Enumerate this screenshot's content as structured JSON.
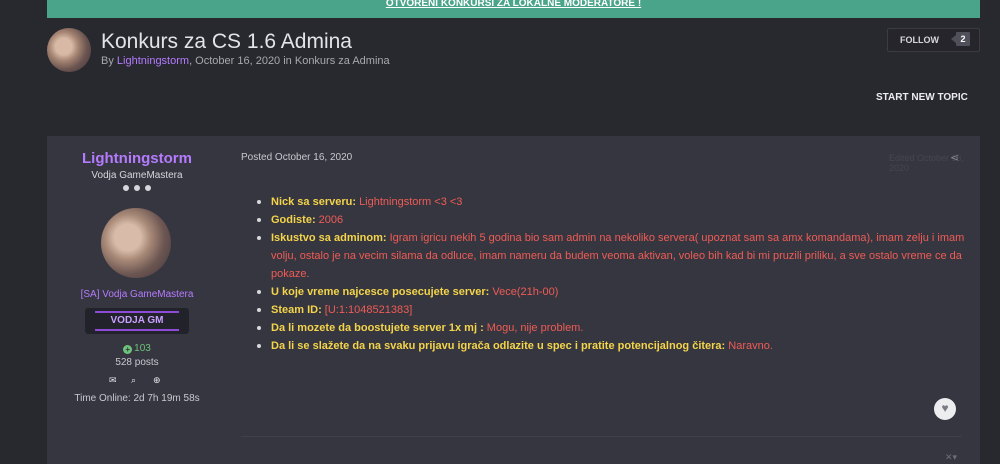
{
  "banner": {
    "text": "OTVORENI KONKURSI ZA LOKALNE MODERATORE !"
  },
  "topic": {
    "title": "Konkurs za CS 1.6 Admina",
    "by_prefix": "By ",
    "author": "Lightningstorm",
    "date_part": ", October 16, 2020 in ",
    "forum": "Konkurs za Admina"
  },
  "follow": {
    "label": "FOLLOW",
    "count": "2"
  },
  "start_topic": "START NEW TOPIC",
  "author_panel": {
    "name": "Lightningstorm",
    "title": "Vodja GameMastera",
    "group": "[SA] Vodja GameMastera",
    "badge": "VODJA GM",
    "reputation": "103",
    "posts": "528 posts",
    "time_online": "Time Online: 2d 7h 19m 58s",
    "icons": [
      "envelope-icon",
      "search-icon",
      "plus-circle-icon"
    ]
  },
  "post": {
    "posted": "Posted October 16, 2020",
    "faded_date": "Edited October 16, 2020",
    "fields": [
      {
        "label": "Nick sa serveru: ",
        "value": "Lightningstorm <3 <3"
      },
      {
        "label": "Godiste: ",
        "value": "2006"
      },
      {
        "label": "Iskustvo sa adminom: ",
        "value": "Igram igricu nekih 5 godina bio sam admin na nekoliko servera( upoznat sam sa amx komandama), imam zelju i imam volju, ostalo je na vecim silama da odluce, imam nameru da budem veoma aktivan, voleo bih kad bi mi pruzili priliku, a sve ostalo vreme ce da pokaze."
      },
      {
        "label": "U koje vreme najcesce posecujete server: ",
        "value": "Vece(21h-00)"
      },
      {
        "label": "Steam ID: ",
        "value": "[U:1:1048521383]"
      },
      {
        "label": "Da li mozete da boostujete server 1x mj : ",
        "value": "Mogu, nije problem."
      },
      {
        "label": "Da li se slažete da na svaku prijavu igrača odlazite u spec i pratite potencijalnog čitera:  ",
        "value": "Naravno."
      }
    ]
  },
  "colors": {
    "accent_purple": "#b57bff",
    "label_yellow": "#f3d44a",
    "value_red": "#ef5c55",
    "banner_green": "#4aa48a",
    "reputation_green": "#6ec37a"
  }
}
